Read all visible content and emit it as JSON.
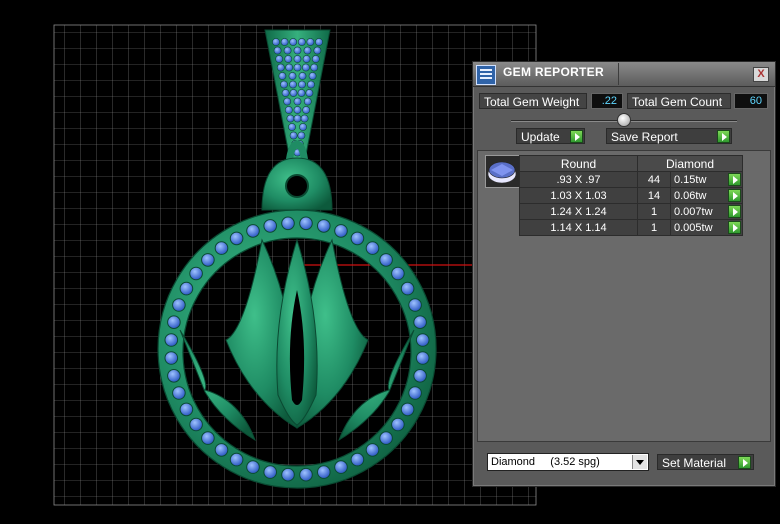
{
  "viewport": {
    "colors": {
      "background": "#000000",
      "grid": "#8c8c8c",
      "metal": "#1f8c64",
      "gem": "#4a7fd8",
      "axis_red": "#d01010",
      "axis_cyan": "#16c0d8"
    }
  },
  "gem_reporter": {
    "title": "GEM REPORTER",
    "close_label": "X",
    "total_gem_weight_label": "Total Gem Weight",
    "total_gem_weight_value": ".22",
    "total_gem_count_label": "Total Gem Count",
    "total_gem_count_value": "60",
    "update_label": "Update",
    "save_report_label": "Save Report",
    "table": {
      "headers": [
        "Round",
        "Diamond"
      ],
      "rows": [
        {
          "size": ".93 X .97",
          "count": "44",
          "weight": "0.15tw"
        },
        {
          "size": "1.03 X 1.03",
          "count": "14",
          "weight": "0.06tw"
        },
        {
          "size": "1.24 X 1.24",
          "count": "1",
          "weight": "0.007tw"
        },
        {
          "size": "1.14 X 1.14",
          "count": "1",
          "weight": "0.005tw"
        }
      ]
    },
    "material_select": {
      "selected": "Diamond     (3.52 spg)"
    },
    "set_material_label": "Set Material"
  }
}
